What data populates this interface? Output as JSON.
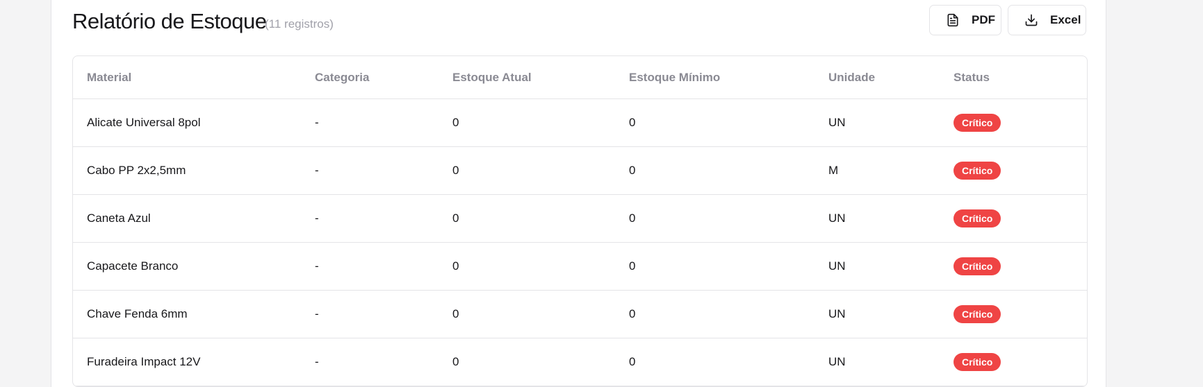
{
  "report": {
    "title": "Relatório de Estoque",
    "count": "(11 registros)"
  },
  "actions": {
    "pdf_label": "PDF",
    "excel_label": "Excel"
  },
  "icons": {
    "pdf": "file-text-icon",
    "excel": "download-icon"
  },
  "colors": {
    "critical_badge": "#ef4444",
    "header_text": "#8a8a93"
  },
  "table": {
    "columns": [
      "Material",
      "Categoria",
      "Estoque Atual",
      "Estoque Mínimo",
      "Unidade",
      "Status"
    ],
    "rows": [
      {
        "material": "Alicate Universal 8pol",
        "categoria": "-",
        "estoque_atual": "0",
        "estoque_minimo": "0",
        "unidade": "UN",
        "status": "Crítico"
      },
      {
        "material": "Cabo PP 2x2,5mm",
        "categoria": "-",
        "estoque_atual": "0",
        "estoque_minimo": "0",
        "unidade": "M",
        "status": "Crítico"
      },
      {
        "material": "Caneta Azul",
        "categoria": "-",
        "estoque_atual": "0",
        "estoque_minimo": "0",
        "unidade": "UN",
        "status": "Crítico"
      },
      {
        "material": "Capacete Branco",
        "categoria": "-",
        "estoque_atual": "0",
        "estoque_minimo": "0",
        "unidade": "UN",
        "status": "Crítico"
      },
      {
        "material": "Chave Fenda 6mm",
        "categoria": "-",
        "estoque_atual": "0",
        "estoque_minimo": "0",
        "unidade": "UN",
        "status": "Crítico"
      },
      {
        "material": "Furadeira Impact 12V",
        "categoria": "-",
        "estoque_atual": "0",
        "estoque_minimo": "0",
        "unidade": "UN",
        "status": "Crítico"
      }
    ]
  }
}
